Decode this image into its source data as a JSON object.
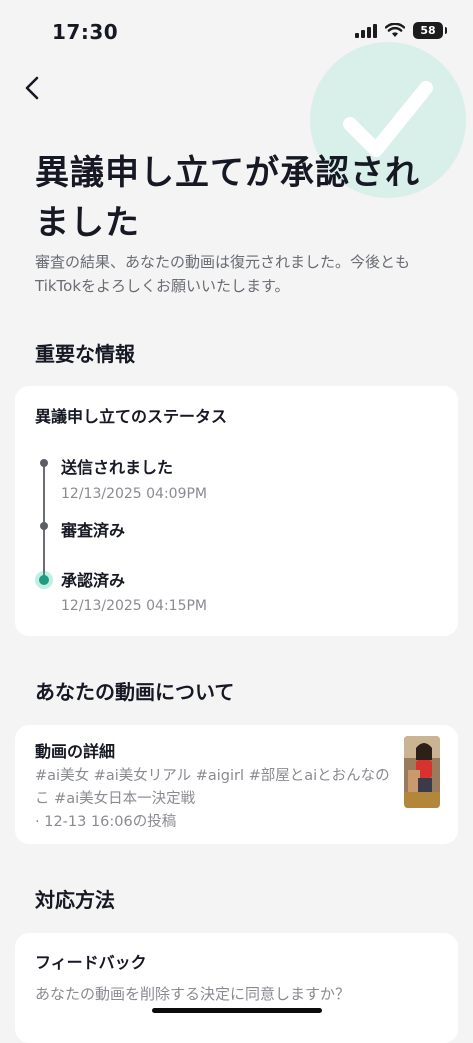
{
  "status_bar": {
    "time": "17:30",
    "battery": "58"
  },
  "header": {
    "title": "異議申し立てが承認されました",
    "subtitle": "審査の結果、あなたの動画は復元されました。今後ともTikTokをよろしくお願いいたします。"
  },
  "important": {
    "section_title": "重要な情報",
    "card_title": "異議申し立てのステータス",
    "steps": [
      {
        "label": "送信されました",
        "time": "12/13/2025 04:09PM"
      },
      {
        "label": "審査済み",
        "time": ""
      },
      {
        "label": "承認済み",
        "time": "12/13/2025 04:15PM"
      }
    ]
  },
  "video": {
    "section_title": "あなたの動画について",
    "card_title": "動画の詳細",
    "description": "#ai美女 #ai美女リアル #aigirl #部屋とaiとおんなのこ #ai美女日本一決定戦",
    "posted": "· 12-13 16:06の投稿"
  },
  "response": {
    "section_title": "対応方法",
    "card_title": "フィードバック",
    "question": "あなたの動画を削除する決定に同意しますか？"
  },
  "colors": {
    "accent": "#1f9b7f",
    "check_bg": "#d9efe9",
    "text_secondary": "#8a8b91"
  }
}
